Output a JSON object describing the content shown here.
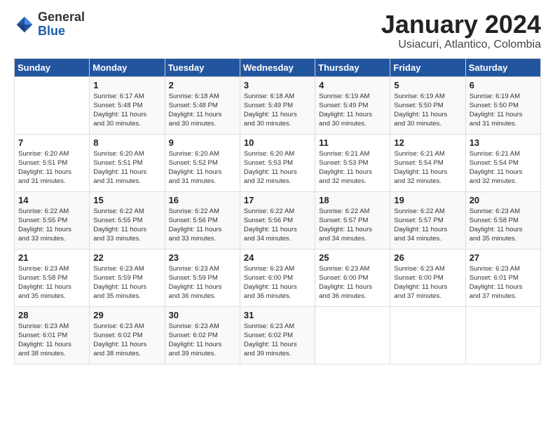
{
  "logo": {
    "general": "General",
    "blue": "Blue"
  },
  "header": {
    "month": "January 2024",
    "location": "Usiacuri, Atlantico, Colombia"
  },
  "days_of_week": [
    "Sunday",
    "Monday",
    "Tuesday",
    "Wednesday",
    "Thursday",
    "Friday",
    "Saturday"
  ],
  "weeks": [
    [
      {
        "day": "",
        "content": ""
      },
      {
        "day": "1",
        "content": "Sunrise: 6:17 AM\nSunset: 5:48 PM\nDaylight: 11 hours\nand 30 minutes."
      },
      {
        "day": "2",
        "content": "Sunrise: 6:18 AM\nSunset: 5:48 PM\nDaylight: 11 hours\nand 30 minutes."
      },
      {
        "day": "3",
        "content": "Sunrise: 6:18 AM\nSunset: 5:49 PM\nDaylight: 11 hours\nand 30 minutes."
      },
      {
        "day": "4",
        "content": "Sunrise: 6:19 AM\nSunset: 5:49 PM\nDaylight: 11 hours\nand 30 minutes."
      },
      {
        "day": "5",
        "content": "Sunrise: 6:19 AM\nSunset: 5:50 PM\nDaylight: 11 hours\nand 30 minutes."
      },
      {
        "day": "6",
        "content": "Sunrise: 6:19 AM\nSunset: 5:50 PM\nDaylight: 11 hours\nand 31 minutes."
      }
    ],
    [
      {
        "day": "7",
        "content": "Sunrise: 6:20 AM\nSunset: 5:51 PM\nDaylight: 11 hours\nand 31 minutes."
      },
      {
        "day": "8",
        "content": "Sunrise: 6:20 AM\nSunset: 5:51 PM\nDaylight: 11 hours\nand 31 minutes."
      },
      {
        "day": "9",
        "content": "Sunrise: 6:20 AM\nSunset: 5:52 PM\nDaylight: 11 hours\nand 31 minutes."
      },
      {
        "day": "10",
        "content": "Sunrise: 6:20 AM\nSunset: 5:53 PM\nDaylight: 11 hours\nand 32 minutes."
      },
      {
        "day": "11",
        "content": "Sunrise: 6:21 AM\nSunset: 5:53 PM\nDaylight: 11 hours\nand 32 minutes."
      },
      {
        "day": "12",
        "content": "Sunrise: 6:21 AM\nSunset: 5:54 PM\nDaylight: 11 hours\nand 32 minutes."
      },
      {
        "day": "13",
        "content": "Sunrise: 6:21 AM\nSunset: 5:54 PM\nDaylight: 11 hours\nand 32 minutes."
      }
    ],
    [
      {
        "day": "14",
        "content": "Sunrise: 6:22 AM\nSunset: 5:55 PM\nDaylight: 11 hours\nand 33 minutes."
      },
      {
        "day": "15",
        "content": "Sunrise: 6:22 AM\nSunset: 5:55 PM\nDaylight: 11 hours\nand 33 minutes."
      },
      {
        "day": "16",
        "content": "Sunrise: 6:22 AM\nSunset: 5:56 PM\nDaylight: 11 hours\nand 33 minutes."
      },
      {
        "day": "17",
        "content": "Sunrise: 6:22 AM\nSunset: 5:56 PM\nDaylight: 11 hours\nand 34 minutes."
      },
      {
        "day": "18",
        "content": "Sunrise: 6:22 AM\nSunset: 5:57 PM\nDaylight: 11 hours\nand 34 minutes."
      },
      {
        "day": "19",
        "content": "Sunrise: 6:22 AM\nSunset: 5:57 PM\nDaylight: 11 hours\nand 34 minutes."
      },
      {
        "day": "20",
        "content": "Sunrise: 6:23 AM\nSunset: 5:58 PM\nDaylight: 11 hours\nand 35 minutes."
      }
    ],
    [
      {
        "day": "21",
        "content": "Sunrise: 6:23 AM\nSunset: 5:58 PM\nDaylight: 11 hours\nand 35 minutes."
      },
      {
        "day": "22",
        "content": "Sunrise: 6:23 AM\nSunset: 5:59 PM\nDaylight: 11 hours\nand 35 minutes."
      },
      {
        "day": "23",
        "content": "Sunrise: 6:23 AM\nSunset: 5:59 PM\nDaylight: 11 hours\nand 36 minutes."
      },
      {
        "day": "24",
        "content": "Sunrise: 6:23 AM\nSunset: 6:00 PM\nDaylight: 11 hours\nand 36 minutes."
      },
      {
        "day": "25",
        "content": "Sunrise: 6:23 AM\nSunset: 6:00 PM\nDaylight: 11 hours\nand 36 minutes."
      },
      {
        "day": "26",
        "content": "Sunrise: 6:23 AM\nSunset: 6:00 PM\nDaylight: 11 hours\nand 37 minutes."
      },
      {
        "day": "27",
        "content": "Sunrise: 6:23 AM\nSunset: 6:01 PM\nDaylight: 11 hours\nand 37 minutes."
      }
    ],
    [
      {
        "day": "28",
        "content": "Sunrise: 6:23 AM\nSunset: 6:01 PM\nDaylight: 11 hours\nand 38 minutes."
      },
      {
        "day": "29",
        "content": "Sunrise: 6:23 AM\nSunset: 6:02 PM\nDaylight: 11 hours\nand 38 minutes."
      },
      {
        "day": "30",
        "content": "Sunrise: 6:23 AM\nSunset: 6:02 PM\nDaylight: 11 hours\nand 39 minutes."
      },
      {
        "day": "31",
        "content": "Sunrise: 6:23 AM\nSunset: 6:02 PM\nDaylight: 11 hours\nand 39 minutes."
      },
      {
        "day": "",
        "content": ""
      },
      {
        "day": "",
        "content": ""
      },
      {
        "day": "",
        "content": ""
      }
    ]
  ]
}
